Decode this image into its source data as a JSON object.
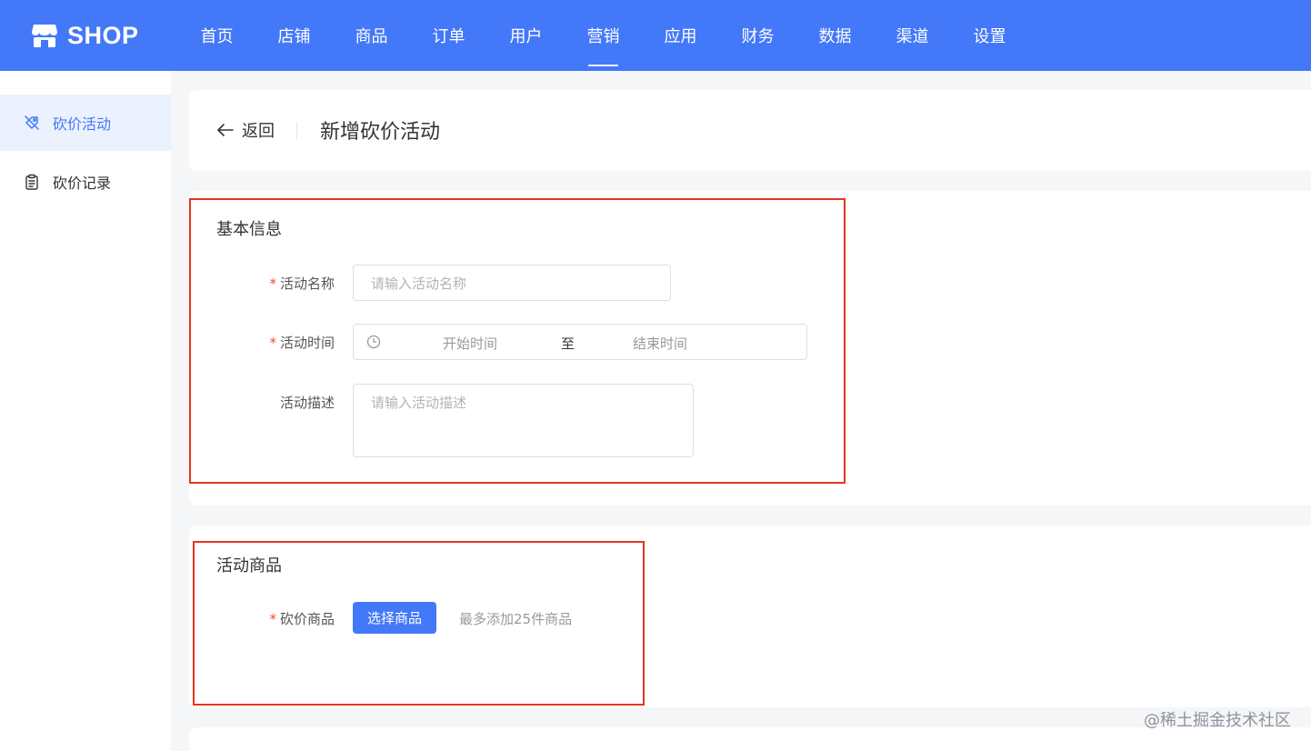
{
  "header": {
    "logo_text": "SHOP",
    "nav": [
      {
        "label": "首页",
        "active": false
      },
      {
        "label": "店铺",
        "active": false
      },
      {
        "label": "商品",
        "active": false
      },
      {
        "label": "订单",
        "active": false
      },
      {
        "label": "用户",
        "active": false
      },
      {
        "label": "营销",
        "active": true
      },
      {
        "label": "应用",
        "active": false
      },
      {
        "label": "财务",
        "active": false
      },
      {
        "label": "数据",
        "active": false
      },
      {
        "label": "渠道",
        "active": false
      },
      {
        "label": "设置",
        "active": false
      }
    ]
  },
  "sidebar": {
    "items": [
      {
        "label": "砍价活动",
        "icon": "bargain-icon",
        "active": true
      },
      {
        "label": "砍价记录",
        "icon": "clipboard-icon",
        "active": false
      }
    ]
  },
  "page": {
    "back_label": "返回",
    "title": "新增砍价活动"
  },
  "basic_info": {
    "title": "基本信息",
    "name_label": "活动名称",
    "name_placeholder": "请输入活动名称",
    "time_label": "活动时间",
    "time_start": "开始时间",
    "time_to": "至",
    "time_end": "结束时间",
    "desc_label": "活动描述",
    "desc_placeholder": "请输入活动描述"
  },
  "goods": {
    "title": "活动商品",
    "goods_label": "砍价商品",
    "select_button": "选择商品",
    "hint": "最多添加25件商品"
  },
  "watermark": "@稀土掘金技术社区",
  "colors": {
    "primary": "#4378f8",
    "required_mark": "#f5483b",
    "annotation": "#e6341f"
  }
}
